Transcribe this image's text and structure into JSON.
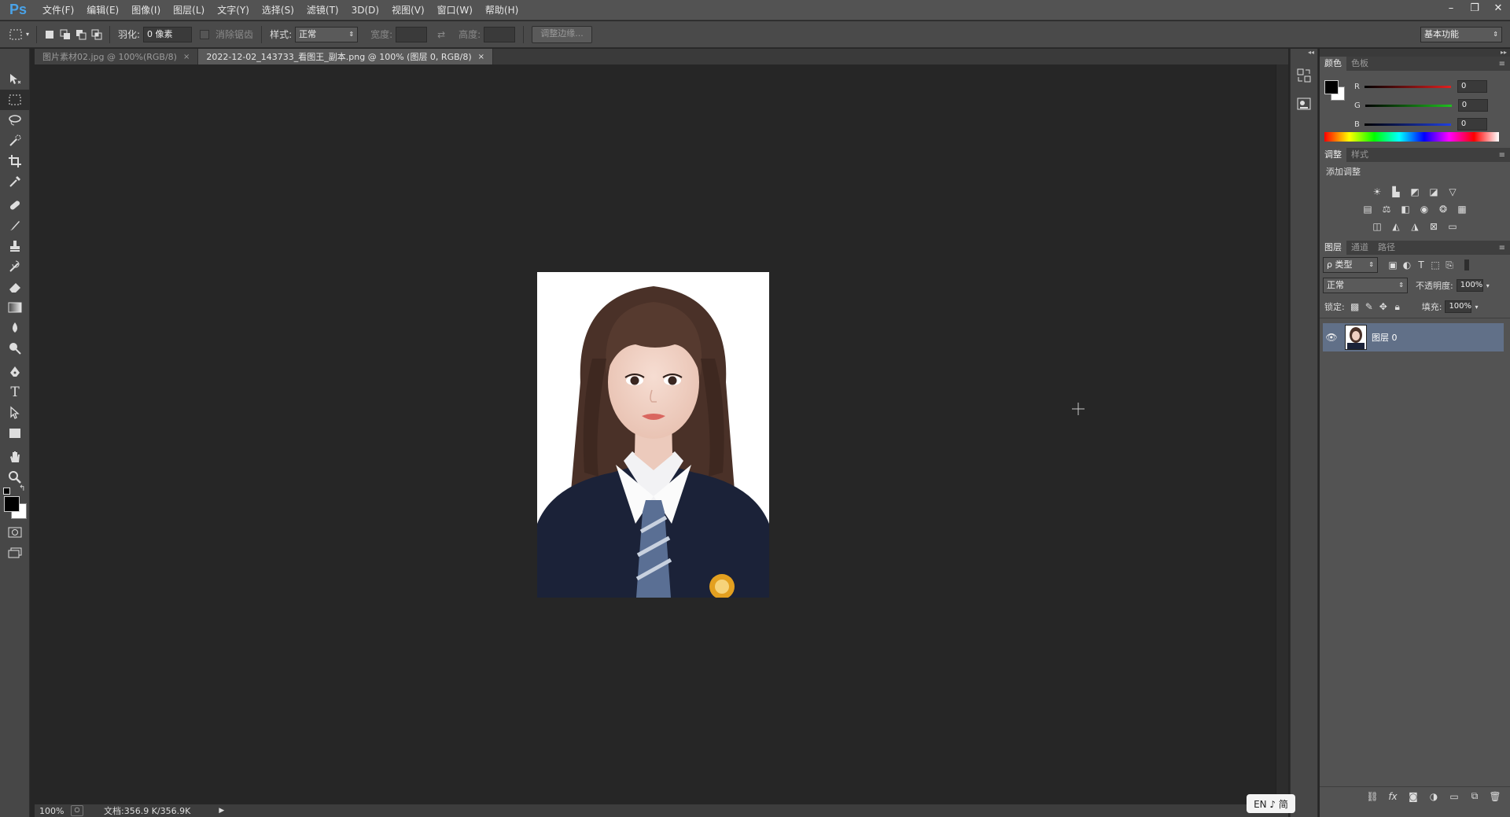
{
  "app": {
    "logo": "Ps"
  },
  "menu": [
    "文件(F)",
    "编辑(E)",
    "图像(I)",
    "图层(L)",
    "文字(Y)",
    "选择(S)",
    "滤镜(T)",
    "3D(D)",
    "视图(V)",
    "窗口(W)",
    "帮助(H)"
  ],
  "window_controls": {
    "minimize": "–",
    "restore": "❐",
    "close": "✕"
  },
  "options": {
    "feather_label": "羽化:",
    "feather_value": "0 像素",
    "antialias_label": "消除锯齿",
    "style_label": "样式:",
    "style_value": "正常",
    "width_label": "宽度:",
    "height_label": "高度:",
    "refine_edge": "调整边缘...",
    "workspace": "基本功能"
  },
  "tabs": [
    {
      "label": "图片素材02.jpg @ 100%(RGB/8)",
      "active": false
    },
    {
      "label": "2022-12-02_143733_看图王_副本.png @ 100% (图层 0, RGB/8)",
      "active": true
    }
  ],
  "status": {
    "zoom": "100%",
    "doc_size": "文档:356.9 K/356.9K"
  },
  "color_panel": {
    "tabs": [
      "颜色",
      "色板"
    ],
    "channels": [
      {
        "label": "R",
        "value": "0",
        "color": "#e02020"
      },
      {
        "label": "G",
        "value": "0",
        "color": "#20c020"
      },
      {
        "label": "B",
        "value": "0",
        "color": "#2040e0"
      }
    ]
  },
  "adjust_panel": {
    "tabs": [
      "调整",
      "样式"
    ],
    "title": "添加调整"
  },
  "layers_panel": {
    "tabs": [
      "图层",
      "通道",
      "路径"
    ],
    "filter_label": "ρ 类型",
    "blend_mode": "正常",
    "opacity_label": "不透明度:",
    "opacity_value": "100%",
    "lock_label": "锁定:",
    "fill_label": "填充:",
    "fill_value": "100%",
    "layers": [
      {
        "name": "图层 0",
        "visible": true
      }
    ]
  },
  "ime": {
    "text": "EN ♪ 简"
  }
}
